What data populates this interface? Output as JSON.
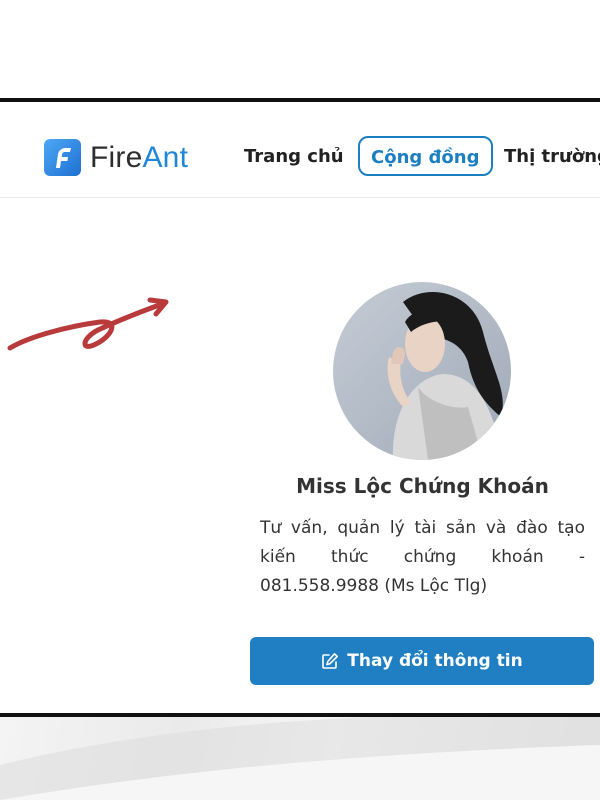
{
  "brand": {
    "name_part1": "Fire",
    "name_part2": "Ant",
    "logo_icon": "fireant-logo-icon"
  },
  "nav": {
    "home": "Trang chủ",
    "community": "Cộng đồng",
    "market": "Thị trường"
  },
  "profile": {
    "name": "Miss Lộc Chứng Khoán",
    "bio": "Tư vấn, quản lý tài sản và đào tạo kiến thức chứng khoán - 081.558.9988 (Ms Lộc Tlg)",
    "edit_button": "Thay đổi thông tin",
    "edit_icon": "edit-icon"
  },
  "colors": {
    "accent": "#1f7fc2",
    "arrow": "#b83a3a",
    "frame": "#111111"
  }
}
